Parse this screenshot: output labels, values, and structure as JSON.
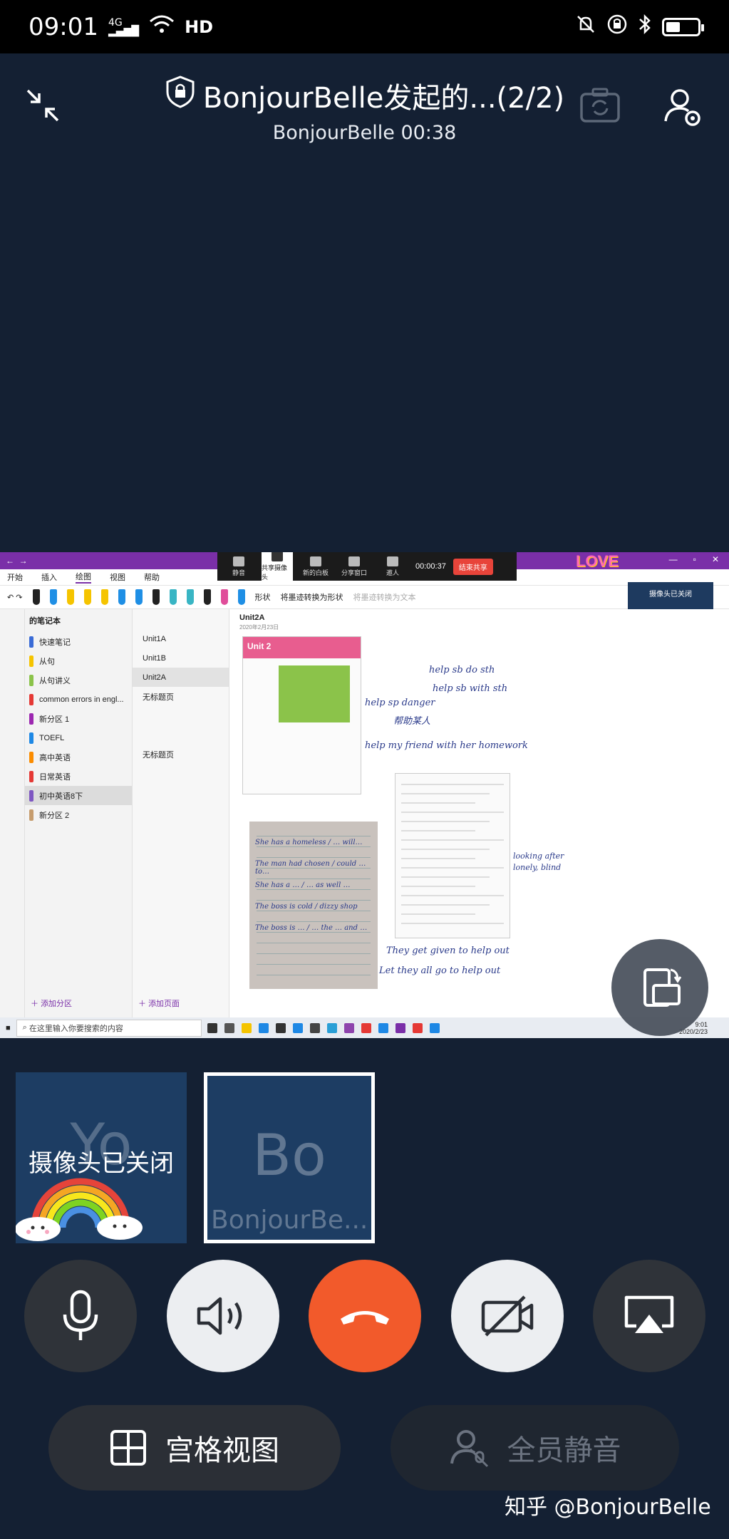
{
  "status_bar": {
    "time": "09:01",
    "network": "4G",
    "hd": "HD"
  },
  "header": {
    "title": "BonjourBelle发起的...(2/2)",
    "host": "BonjourBelle",
    "duration": "00:38"
  },
  "shared_screen": {
    "ribbon_tabs": [
      "开始",
      "插入",
      "绘图",
      "视图",
      "帮助"
    ],
    "selected_tab": "绘图",
    "pen_colors": [
      "#222222",
      "#1f8fe5",
      "#f5c400",
      "#f5c400",
      "#f5c400",
      "#1f8fe5",
      "#1f8fe5",
      "#222222",
      "#39b5c4",
      "#39b5c4",
      "#222222",
      "#e04d9a",
      "#1f8fe5"
    ],
    "tool_labels": [
      "形状",
      "将墨迹转换为形状",
      "将墨迹转换为文本"
    ],
    "meeting_toolbar": {
      "buttons": [
        "静音",
        "共享摄像头",
        "新的白板",
        "分享窗口",
        "邀人"
      ],
      "timer": "00:00:37",
      "end_label": "结束共享"
    },
    "love_sticker": "LOVE",
    "cam_thumb_label": "摄像头已关闭",
    "notebook_name": "的笔记本",
    "sections": [
      {
        "label": "快速笔记",
        "color": "#3a6bd6"
      },
      {
        "label": "从句",
        "color": "#f5c400"
      },
      {
        "label": "从句讲义",
        "color": "#8bc34a"
      },
      {
        "label": "common errors in engl...",
        "color": "#e53935"
      },
      {
        "label": "新分区 1",
        "color": "#9c27b0"
      },
      {
        "label": "TOEFL",
        "color": "#1e88e5"
      },
      {
        "label": "高中英语",
        "color": "#fb8c00"
      },
      {
        "label": "日常英语",
        "color": "#e53935"
      },
      {
        "label": "初中英语8下",
        "color": "#7e57c2"
      },
      {
        "label": "新分区 2",
        "color": "#c69c6d"
      }
    ],
    "selected_section": 8,
    "pages": [
      "Unit1A",
      "Unit1B",
      "Unit2A",
      "无标题页",
      "",
      "",
      "无标题页"
    ],
    "selected_page": 2,
    "add_section": "添加分区",
    "add_page": "添加页面",
    "page_title": "Unit2A",
    "page_date": "2020年2月23日",
    "textbook_unit": "Unit 2",
    "handwriting": [
      "help sb do sth",
      "help sb with sth",
      "help sp danger",
      "帮助某人",
      "help my friend with her homework",
      "They get given to help out",
      "Let they all go to help out",
      "looking after",
      "lonely, blind"
    ],
    "photo_lines": [
      "She has a homeless / … will…",
      "The man had chosen / could … to…",
      "She has a … / … as well …",
      "The boss is cold / dizzy shop",
      "The boss is … / … the … and …"
    ],
    "taskbar_search": "在这里输入你要搜索的内容",
    "taskbar_date": "2020/2/23",
    "taskbar_time": "9:01"
  },
  "participants": [
    {
      "initials": "Yo",
      "camera_status": "摄像头已关闭",
      "name": ""
    },
    {
      "initials": "Bo",
      "camera_status": "",
      "name": "BonjourBe..."
    }
  ],
  "controls": [
    "microphone",
    "speaker",
    "hang-up",
    "camera-off",
    "screen-cast"
  ],
  "bottom": {
    "grid_view_label": "宫格视图",
    "mute_all_label": "全员静音"
  },
  "watermark": "知乎 @BonjourBelle",
  "colors": {
    "background": "#142033",
    "hangup": "#f25a2b",
    "onenote_purple": "#7a2fa8"
  }
}
